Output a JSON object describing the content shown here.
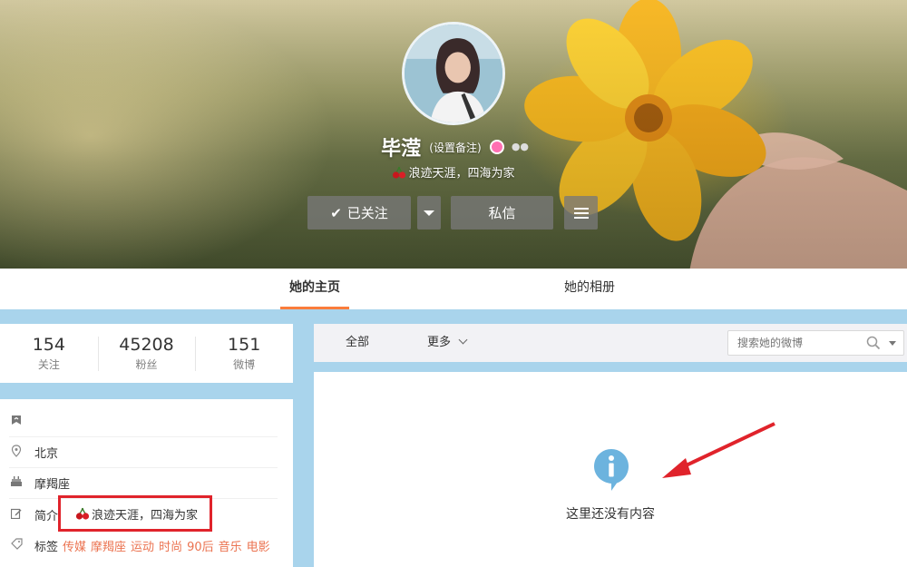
{
  "profile": {
    "name": "毕滢",
    "set_remark": "(设置备注)",
    "motto": "浪迹天涯，四海为家"
  },
  "actions": {
    "follow_label": "已关注",
    "message_label": "私信"
  },
  "tabs": [
    {
      "label": "她的主页",
      "active": true
    },
    {
      "label": "她的相册",
      "active": false
    }
  ],
  "stats": [
    {
      "value": "154",
      "label": "关注"
    },
    {
      "value": "45208",
      "label": "粉丝"
    },
    {
      "value": "151",
      "label": "微博"
    }
  ],
  "info": {
    "location": "北京",
    "zodiac": "摩羯座",
    "bio_label": "简介",
    "bio": "浪迹天涯，四海为家",
    "tags_label": "标签",
    "tags": [
      "传媒",
      "摩羯座",
      "运动",
      "时尚",
      "90后",
      "音乐",
      "电影"
    ]
  },
  "feed": {
    "filter_all": "全部",
    "filter_more": "更多",
    "search_placeholder": "搜索她的微博",
    "empty_text": "这里还没有内容"
  },
  "colors": {
    "accent_orange": "#fa7d3c",
    "tag_color": "#eb7350",
    "highlight_red": "#e0232b",
    "page_bg": "#a9d4ec",
    "info_icon": "#6cb3de"
  }
}
